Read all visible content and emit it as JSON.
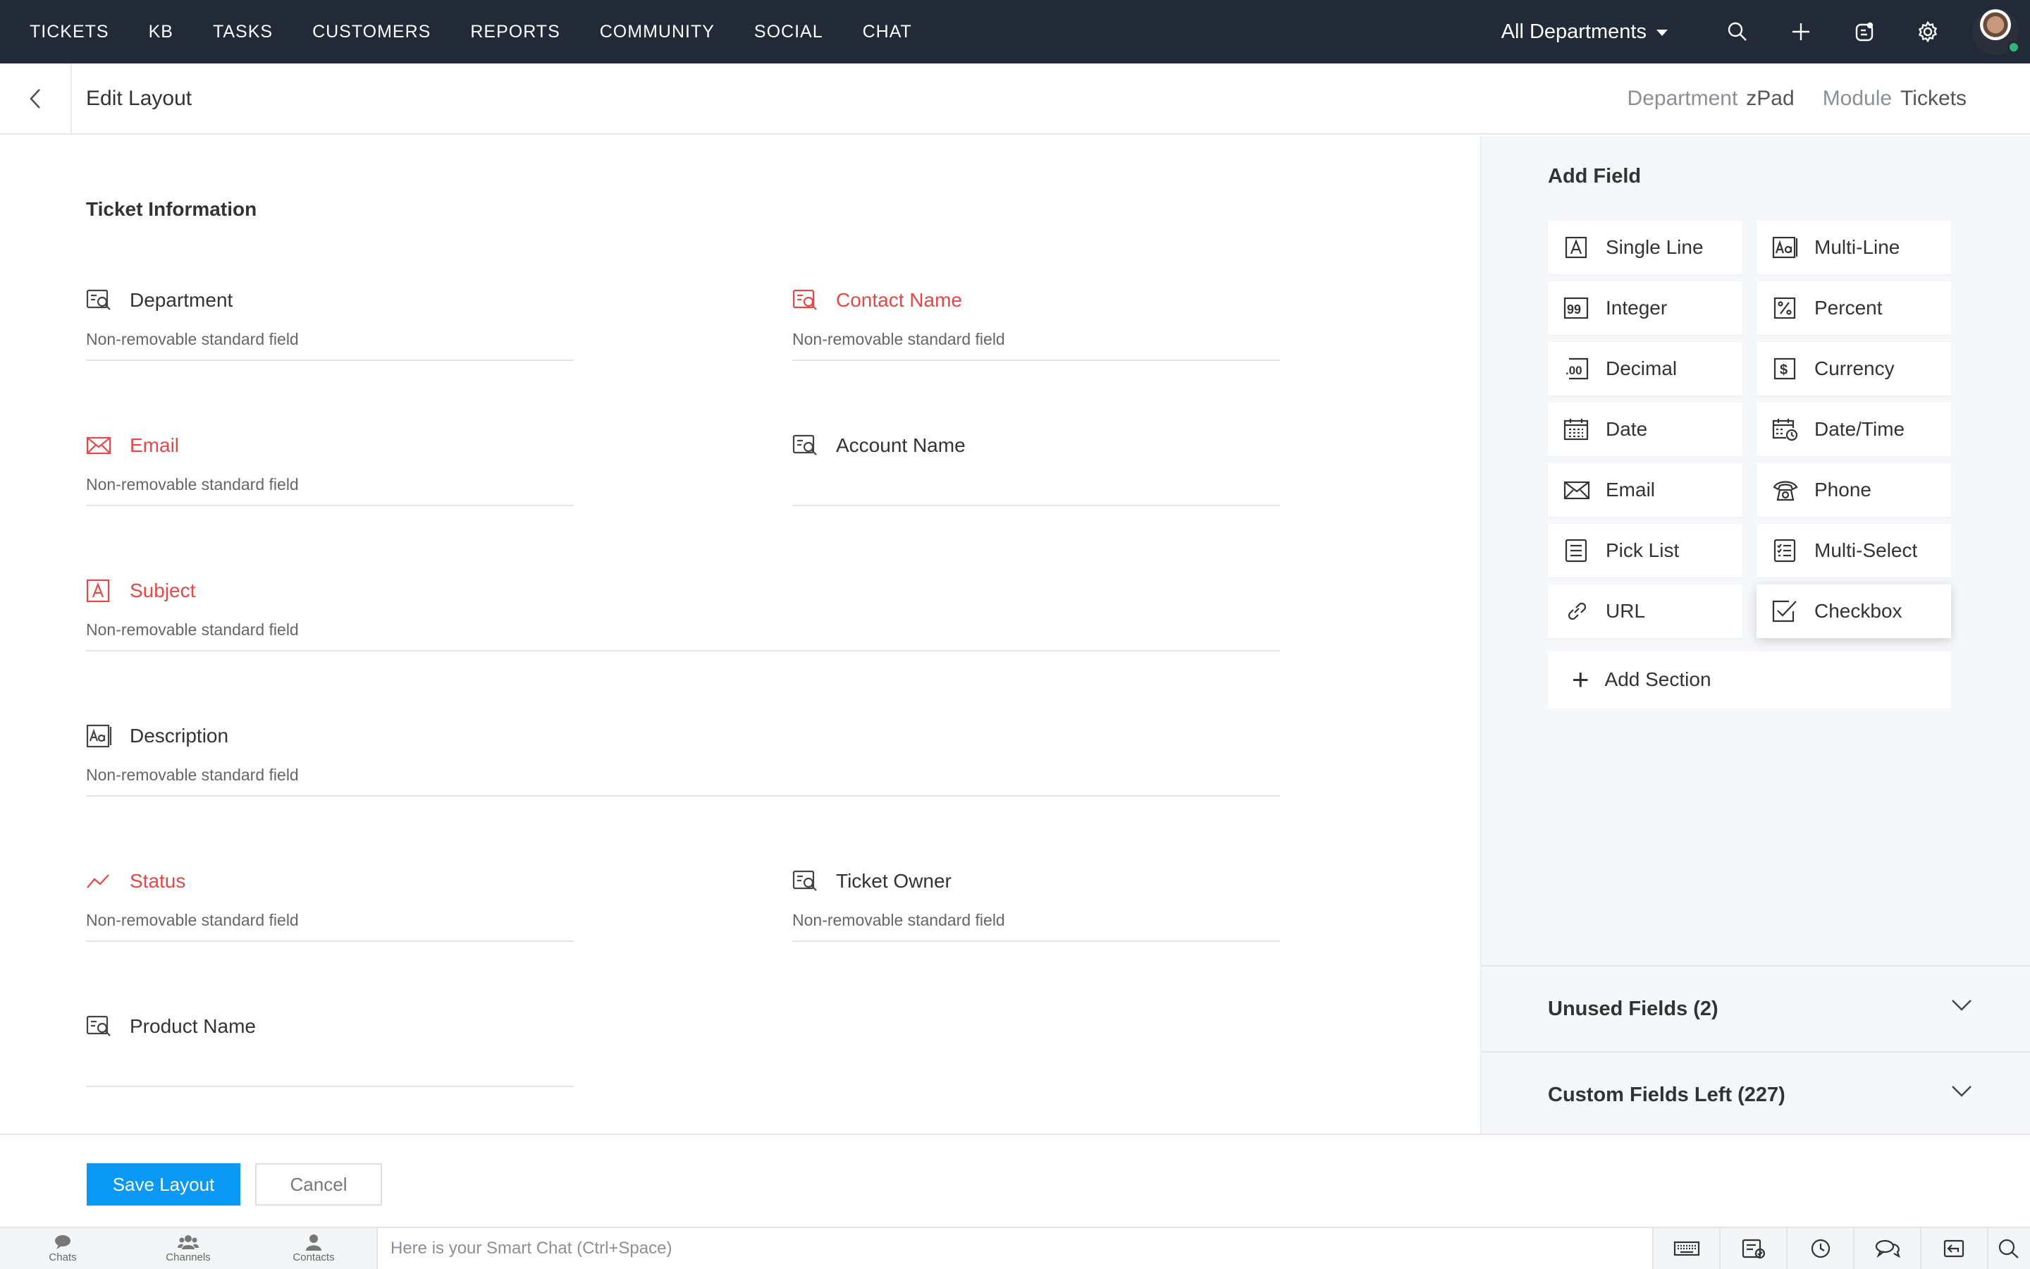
{
  "topnav": {
    "items": [
      "TICKETS",
      "KB",
      "TASKS",
      "CUSTOMERS",
      "REPORTS",
      "COMMUNITY",
      "SOCIAL",
      "CHAT"
    ],
    "department_selector": "All Departments"
  },
  "header": {
    "title": "Edit Layout",
    "department_label": "Department",
    "department_value": "zPad",
    "module_label": "Module",
    "module_value": "Tickets"
  },
  "form": {
    "section_title": "Ticket Information",
    "fields": [
      {
        "name": "Department",
        "note": "Non-removable standard field",
        "icon": "lookup-icon",
        "required": false
      },
      {
        "name": "Contact Name",
        "note": "Non-removable standard field",
        "icon": "lookup-icon",
        "required": true
      },
      {
        "name": "Email",
        "note": "Non-removable standard field",
        "icon": "email-icon",
        "required": true
      },
      {
        "name": "Account Name",
        "note": "",
        "icon": "lookup-icon",
        "required": false
      },
      {
        "name": "Subject",
        "note": "Non-removable standard field",
        "icon": "single-line-icon",
        "required": true
      },
      {
        "name": "Description",
        "note": "Non-removable standard field",
        "icon": "multi-line-icon",
        "required": false
      },
      {
        "name": "Status",
        "note": "Non-removable standard field",
        "icon": "status-icon",
        "required": true
      },
      {
        "name": "Ticket Owner",
        "note": "Non-removable standard field",
        "icon": "lookup-icon",
        "required": false
      },
      {
        "name": "Product Name",
        "note": "",
        "icon": "lookup-icon",
        "required": false
      }
    ]
  },
  "panel": {
    "title": "Add Field",
    "field_types": [
      {
        "label": "Single Line",
        "icon": "single-line-icon"
      },
      {
        "label": "Multi-Line",
        "icon": "multi-line-icon"
      },
      {
        "label": "Integer",
        "icon": "integer-icon"
      },
      {
        "label": "Percent",
        "icon": "percent-icon"
      },
      {
        "label": "Decimal",
        "icon": "decimal-icon"
      },
      {
        "label": "Currency",
        "icon": "currency-icon"
      },
      {
        "label": "Date",
        "icon": "date-icon"
      },
      {
        "label": "Date/Time",
        "icon": "datetime-icon"
      },
      {
        "label": "Email",
        "icon": "email-icon"
      },
      {
        "label": "Phone",
        "icon": "phone-icon"
      },
      {
        "label": "Pick List",
        "icon": "picklist-icon"
      },
      {
        "label": "Multi-Select",
        "icon": "multiselect-icon"
      },
      {
        "label": "URL",
        "icon": "url-icon"
      },
      {
        "label": "Checkbox",
        "icon": "checkbox-icon"
      }
    ],
    "add_section": "Add Section",
    "unused_fields_label": "Unused Fields",
    "unused_fields_count": "(2)",
    "custom_fields_label": "Custom Fields Left",
    "custom_fields_count": "(227)"
  },
  "actions": {
    "save": "Save Layout",
    "cancel": "Cancel"
  },
  "chatbar": {
    "tabs": [
      "Chats",
      "Channels",
      "Contacts"
    ],
    "placeholder": "Here is your Smart Chat (Ctrl+Space)"
  },
  "colors": {
    "nav_bg": "#222a37",
    "required": "#e64848",
    "primary_button": "#0a98f5",
    "panel_bg": "#f6f7fa",
    "online": "#2fb676"
  }
}
